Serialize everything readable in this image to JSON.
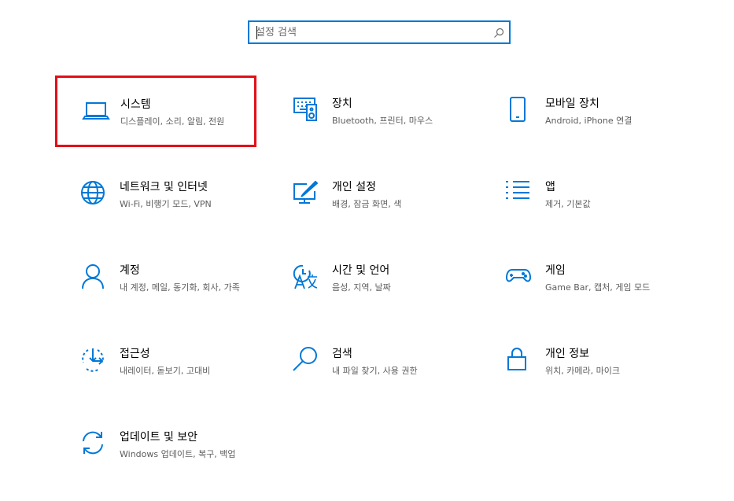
{
  "search": {
    "placeholder": "설정 검색",
    "value": ""
  },
  "colors": {
    "accent": "#0078d7",
    "selection": "#e30f17"
  },
  "tiles": [
    {
      "title": "시스템",
      "subtitle": "디스플레이, 소리, 알림, 전원",
      "icon": "laptop-icon",
      "selected": true
    },
    {
      "title": "장치",
      "subtitle": "Bluetooth, 프린터, 마우스",
      "icon": "keyboard-speaker-icon"
    },
    {
      "title": "모바일 장치",
      "subtitle": "Android, iPhone 연결",
      "icon": "phone-icon"
    },
    {
      "title": "네트워크 및 인터넷",
      "subtitle": "Wi-Fi, 비행기 모드, VPN",
      "icon": "globe-icon"
    },
    {
      "title": "개인 설정",
      "subtitle": "배경, 잠금 화면, 색",
      "icon": "personalization-icon"
    },
    {
      "title": "앱",
      "subtitle": "제거, 기본값",
      "icon": "apps-list-icon"
    },
    {
      "title": "계정",
      "subtitle": "내 계정, 메일, 동기화, 회사, 가족",
      "icon": "person-icon"
    },
    {
      "title": "시간 및 언어",
      "subtitle": "음성, 지역, 날짜",
      "icon": "time-language-icon"
    },
    {
      "title": "게임",
      "subtitle": "Game Bar, 캡처, 게임 모드",
      "icon": "gamepad-icon"
    },
    {
      "title": "접근성",
      "subtitle": "내레이터, 돋보기, 고대비",
      "icon": "ease-of-access-icon"
    },
    {
      "title": "검색",
      "subtitle": "내 파일 찾기, 사용 권한",
      "icon": "search-icon"
    },
    {
      "title": "개인 정보",
      "subtitle": "위치, 카메라, 마이크",
      "icon": "lock-icon"
    },
    {
      "title": "업데이트 및 보안",
      "subtitle": "Windows 업데이트, 복구, 백업",
      "icon": "sync-icon"
    }
  ]
}
